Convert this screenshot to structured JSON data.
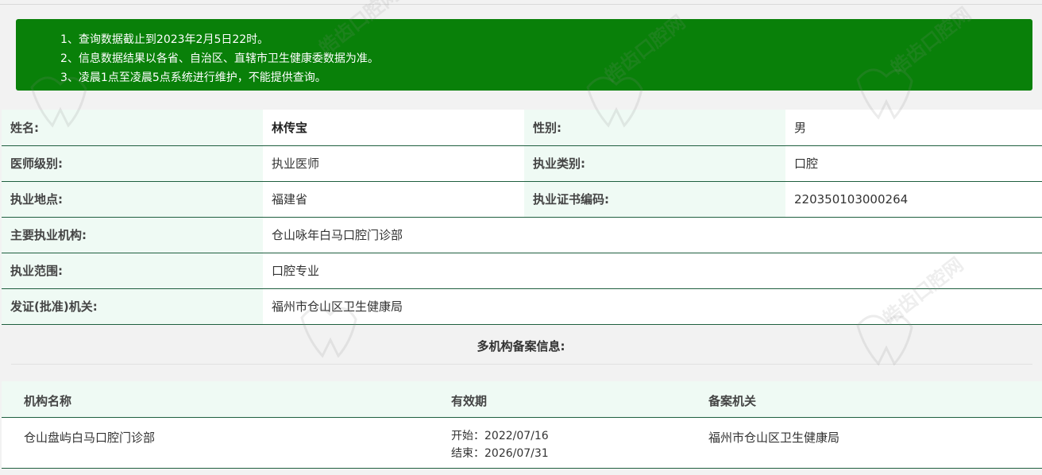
{
  "notices": [
    "1、查询数据截止到2023年2月5日22时。",
    "2、信息数据结果以各省、自治区、直辖市卫生健康委数据为准。",
    "3、凌晨1点至凌晨5点系统进行维护，不能提供查询。"
  ],
  "info": {
    "name_label": "姓名:",
    "name_value": "林传宝",
    "gender_label": "性别:",
    "gender_value": "男",
    "level_label": "医师级别:",
    "level_value": "执业医师",
    "category_label": "执业类别:",
    "category_value": "口腔",
    "location_label": "执业地点:",
    "location_value": "福建省",
    "cert_label": "执业证书编码:",
    "cert_value": "220350103000264",
    "institution_label": "主要执业机构:",
    "institution_value": "仓山咏年白马口腔门诊部",
    "scope_label": "执业范围:",
    "scope_value": "口腔专业",
    "issuer_label": "发证(批准)机关:",
    "issuer_value": "福州市仓山区卫生健康局"
  },
  "multi": {
    "title": "多机构备案信息:",
    "headers": [
      "机构名称",
      "有效期",
      "备案机关"
    ],
    "rows": [
      {
        "name": "仓山盘屿白马口腔门诊部",
        "start": "开始：2022/07/16",
        "end": "结束：2026/07/31",
        "authority": "福州市仓山区卫生健康局"
      }
    ]
  },
  "watermark": {
    "text": "皓齿口腔网"
  },
  "colors": {
    "accent": "#098009",
    "label_bg": "#effaf4",
    "border": "#1f5f3f"
  }
}
